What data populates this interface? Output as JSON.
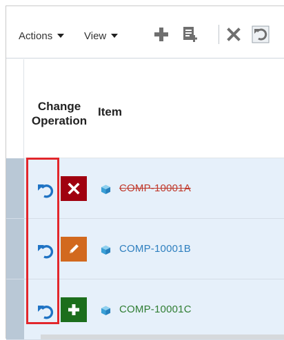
{
  "toolbar": {
    "actions_label": "Actions",
    "view_label": "View",
    "icons": [
      "add-icon",
      "add-detail-icon",
      "delete-icon",
      "undo-icon"
    ]
  },
  "table": {
    "columns": [
      "Change Operation",
      "Item"
    ],
    "column_change_line1": "Change",
    "column_change_line2": "Operation",
    "column_item": "Item",
    "rows": [
      {
        "operation": "delete",
        "item": "COMP-10001A",
        "color": "#c0392b",
        "badge_color": "#a0000f"
      },
      {
        "operation": "edit",
        "item": "COMP-10001B",
        "color": "#2e7fbf",
        "badge_color": "#d2691e"
      },
      {
        "operation": "add",
        "item": "COMP-10001C",
        "color": "#2f7d32",
        "badge_color": "#1c6e1c"
      }
    ]
  },
  "colors": {
    "row_bg": "#e6f0fa",
    "gutter": "#b9c8d6",
    "highlight_border": "#e2262b",
    "undo_blue": "#1f73c4"
  }
}
